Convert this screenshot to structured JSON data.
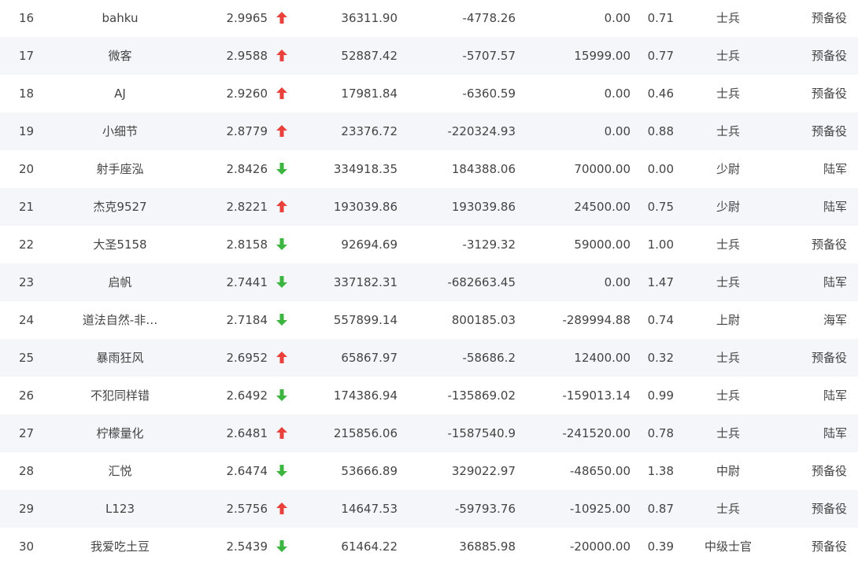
{
  "colors": {
    "up": "#e8413b",
    "down": "#3bb53f",
    "text": "#444444",
    "row_alt": "#f4f6f9"
  },
  "rows": [
    {
      "rank": "16",
      "name": "bahku",
      "score": "2.9965",
      "trend": "up",
      "v1": "36311.90",
      "v2": "-4778.26",
      "v3": "0.00",
      "ratio": "0.71",
      "title": "士兵",
      "branch": "预备役"
    },
    {
      "rank": "17",
      "name": "微客",
      "score": "2.9588",
      "trend": "up",
      "v1": "52887.42",
      "v2": "-5707.57",
      "v3": "15999.00",
      "ratio": "0.77",
      "title": "士兵",
      "branch": "预备役"
    },
    {
      "rank": "18",
      "name": "AJ",
      "score": "2.9260",
      "trend": "up",
      "v1": "17981.84",
      "v2": "-6360.59",
      "v3": "0.00",
      "ratio": "0.46",
      "title": "士兵",
      "branch": "预备役"
    },
    {
      "rank": "19",
      "name": "小细节",
      "score": "2.8779",
      "trend": "up",
      "v1": "23376.72",
      "v2": "-220324.93",
      "v3": "0.00",
      "ratio": "0.88",
      "title": "士兵",
      "branch": "预备役"
    },
    {
      "rank": "20",
      "name": "射手座泓",
      "score": "2.8426",
      "trend": "down",
      "v1": "334918.35",
      "v2": "184388.06",
      "v3": "70000.00",
      "ratio": "0.00",
      "title": "少尉",
      "branch": "陆军"
    },
    {
      "rank": "21",
      "name": "杰克9527",
      "score": "2.8221",
      "trend": "up",
      "v1": "193039.86",
      "v2": "193039.86",
      "v3": "24500.00",
      "ratio": "0.75",
      "title": "少尉",
      "branch": "陆军"
    },
    {
      "rank": "22",
      "name": "大圣5158",
      "score": "2.8158",
      "trend": "down",
      "v1": "92694.69",
      "v2": "-3129.32",
      "v3": "59000.00",
      "ratio": "1.00",
      "title": "士兵",
      "branch": "预备役"
    },
    {
      "rank": "23",
      "name": "启帆",
      "score": "2.7441",
      "trend": "down",
      "v1": "337182.31",
      "v2": "-682663.45",
      "v3": "0.00",
      "ratio": "1.47",
      "title": "士兵",
      "branch": "陆军"
    },
    {
      "rank": "24",
      "name": "道法自然-非…",
      "score": "2.7184",
      "trend": "down",
      "v1": "557899.14",
      "v2": "800185.03",
      "v3": "-289994.88",
      "ratio": "0.74",
      "title": "上尉",
      "branch": "海军"
    },
    {
      "rank": "25",
      "name": "暴雨狂风",
      "score": "2.6952",
      "trend": "up",
      "v1": "65867.97",
      "v2": "-58686.2",
      "v3": "12400.00",
      "ratio": "0.32",
      "title": "士兵",
      "branch": "预备役"
    },
    {
      "rank": "26",
      "name": "不犯同样错",
      "score": "2.6492",
      "trend": "down",
      "v1": "174386.94",
      "v2": "-135869.02",
      "v3": "-159013.14",
      "ratio": "0.99",
      "title": "士兵",
      "branch": "陆军"
    },
    {
      "rank": "27",
      "name": "柠檬量化",
      "score": "2.6481",
      "trend": "up",
      "v1": "215856.06",
      "v2": "-1587540.9",
      "v3": "-241520.00",
      "ratio": "0.78",
      "title": "士兵",
      "branch": "陆军"
    },
    {
      "rank": "28",
      "name": "汇悦",
      "score": "2.6474",
      "trend": "down",
      "v1": "53666.89",
      "v2": "329022.97",
      "v3": "-48650.00",
      "ratio": "1.38",
      "title": "中尉",
      "branch": "预备役"
    },
    {
      "rank": "29",
      "name": "L123",
      "score": "2.5756",
      "trend": "up",
      "v1": "14647.53",
      "v2": "-59793.76",
      "v3": "-10925.00",
      "ratio": "0.87",
      "title": "士兵",
      "branch": "预备役"
    },
    {
      "rank": "30",
      "name": "我爱吃土豆",
      "score": "2.5439",
      "trend": "down",
      "v1": "61464.22",
      "v2": "36885.98",
      "v3": "-20000.00",
      "ratio": "0.39",
      "title": "中级士官",
      "branch": "预备役"
    }
  ]
}
